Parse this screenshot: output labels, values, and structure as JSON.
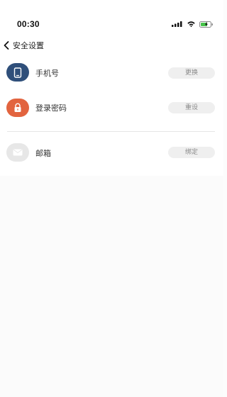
{
  "status_bar": {
    "time": "00:30",
    "icons": [
      "signal-icon",
      "wifi-icon",
      "battery-icon"
    ]
  },
  "nav": {
    "back_icon": "chevron-left-icon",
    "title": "安全设置"
  },
  "items": [
    {
      "id": "phone",
      "icon": "phone-icon",
      "icon_bg": "#2f4f7a",
      "label": "手机号",
      "action": "更换"
    },
    {
      "id": "password",
      "icon": "lock-icon",
      "icon_bg": "#e2643f",
      "label": "登录密码",
      "action": "重设"
    },
    {
      "id": "email",
      "icon": "mail-icon",
      "icon_bg": "#e7e7e7",
      "label": "邮箱",
      "action": "绑定"
    }
  ],
  "colors": {
    "pill_bg": "#efefef",
    "pill_text": "#8a8a8a",
    "divider": "#e6e6e6",
    "battery_green": "#46c34a"
  }
}
